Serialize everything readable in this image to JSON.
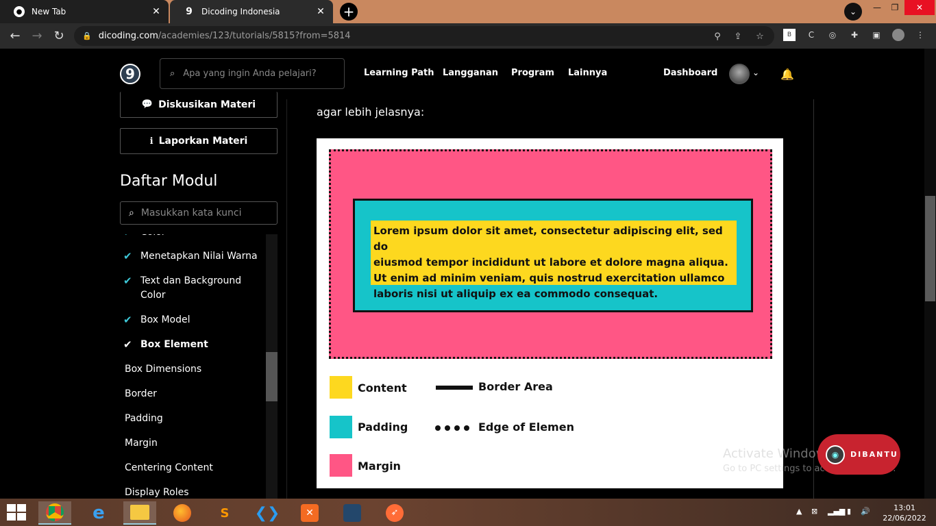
{
  "browser": {
    "tabs": [
      {
        "title": "New Tab",
        "close": "✕"
      },
      {
        "title": "Dicoding Indonesia",
        "close": "✕"
      }
    ],
    "new_tab": "+",
    "url_host": "dicoding.com",
    "url_path": "/academies/123/tutorials/5815?from=5814"
  },
  "header": {
    "logo": "9",
    "search_placeholder": "Apa yang ingin Anda pelajari?",
    "nav": [
      "Learning Path",
      "Langganan",
      "Program",
      "Lainnya"
    ],
    "dashboard": "Dashboard"
  },
  "sidebar": {
    "discuss_button": "Diskusikan Materi",
    "report_button": "Laporkan Materi",
    "module_title": "Daftar Modul",
    "module_search_placeholder": "Masukkan kata kunci",
    "items": [
      {
        "label": "Color",
        "done": true
      },
      {
        "label": "Menetapkan Nilai Warna",
        "done": true
      },
      {
        "label": "Text dan Background Color",
        "done": true
      },
      {
        "label": "Box Model",
        "done": true
      },
      {
        "label": "Box Element",
        "done": true,
        "current": true
      },
      {
        "label": "Box Dimensions",
        "done": false
      },
      {
        "label": "Border",
        "done": false
      },
      {
        "label": "Padding",
        "done": false
      },
      {
        "label": "Margin",
        "done": false
      },
      {
        "label": "Centering Content",
        "done": false
      },
      {
        "label": "Display Roles",
        "done": false
      }
    ]
  },
  "content": {
    "intro": "agar lebih jelasnya:",
    "lorem": [
      "Lorem ipsum dolor sit amet, consectetur adipiscing elit, sed do",
      "eiusmod tempor incididunt ut labore et dolore magna aliqua.",
      "Ut enim ad minim veniam, quis nostrud exercitation ullamco",
      "laboris nisi ut aliquip ex ea commodo consequat."
    ],
    "legend": {
      "content": "Content",
      "padding": "Padding",
      "margin": "Margin",
      "border_area": "Border Area",
      "edge": "Edge of Elemen"
    },
    "colors": {
      "content": "#fdd81f",
      "padding": "#16c4c9",
      "margin": "#ff5685"
    }
  },
  "overlay": {
    "watermark_title": "Activate Windows",
    "watermark_sub": "Go to PC settings to activate Windows.",
    "chat_label": "DIBANTU"
  },
  "taskbar": {
    "time": "13:01",
    "date": "22/06/2022"
  }
}
